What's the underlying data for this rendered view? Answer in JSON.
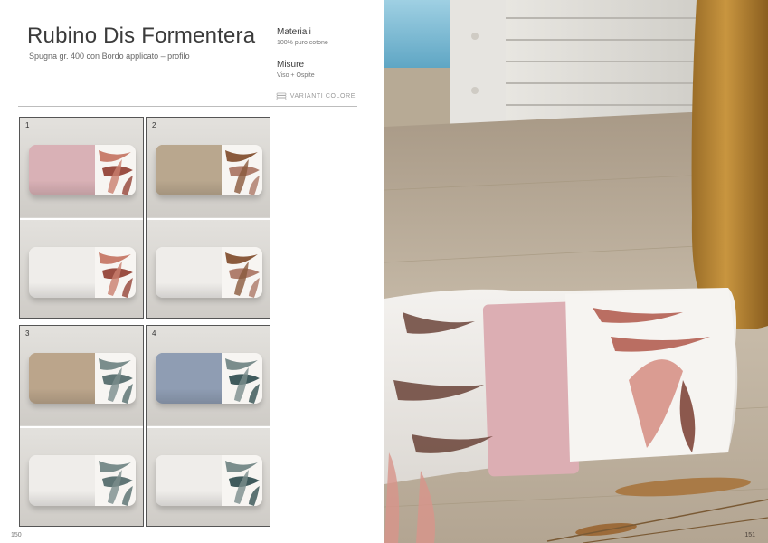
{
  "product": {
    "title": "Rubino Dis Formentera",
    "subtitle": "Spugna gr. 400 con Bordo applicato – profilo"
  },
  "specs": {
    "materials_label": "Materiali",
    "materials_value": "100% puro cotone",
    "sizes_label": "Misure",
    "sizes_value": "Viso + Ospite"
  },
  "variants_label": "VARIANTI COLORE",
  "swatches": [
    {
      "number": "1",
      "terry_top": "#d9b1b6",
      "terry_bottom": "#efedea",
      "leaf_top": "#c97f6e",
      "leaf_bottom": "#9a4e42"
    },
    {
      "number": "2",
      "terry_top": "#b9a78e",
      "terry_bottom": "#efedea",
      "leaf_top": "#8a5a3c",
      "leaf_bottom": "#b07f6e"
    },
    {
      "number": "3",
      "terry_top": "#bba58b",
      "terry_bottom": "#efedea",
      "leaf_top": "#7a8d8c",
      "leaf_bottom": "#5f7575"
    },
    {
      "number": "4",
      "terry_top": "#8f9db3",
      "terry_bottom": "#efedea",
      "leaf_top": "#7a8d8c",
      "leaf_bottom": "#3f5a5c"
    }
  ],
  "page_numbers": {
    "left": "150",
    "right": "151"
  },
  "icons": {
    "variants": "towel-stack-icon"
  }
}
